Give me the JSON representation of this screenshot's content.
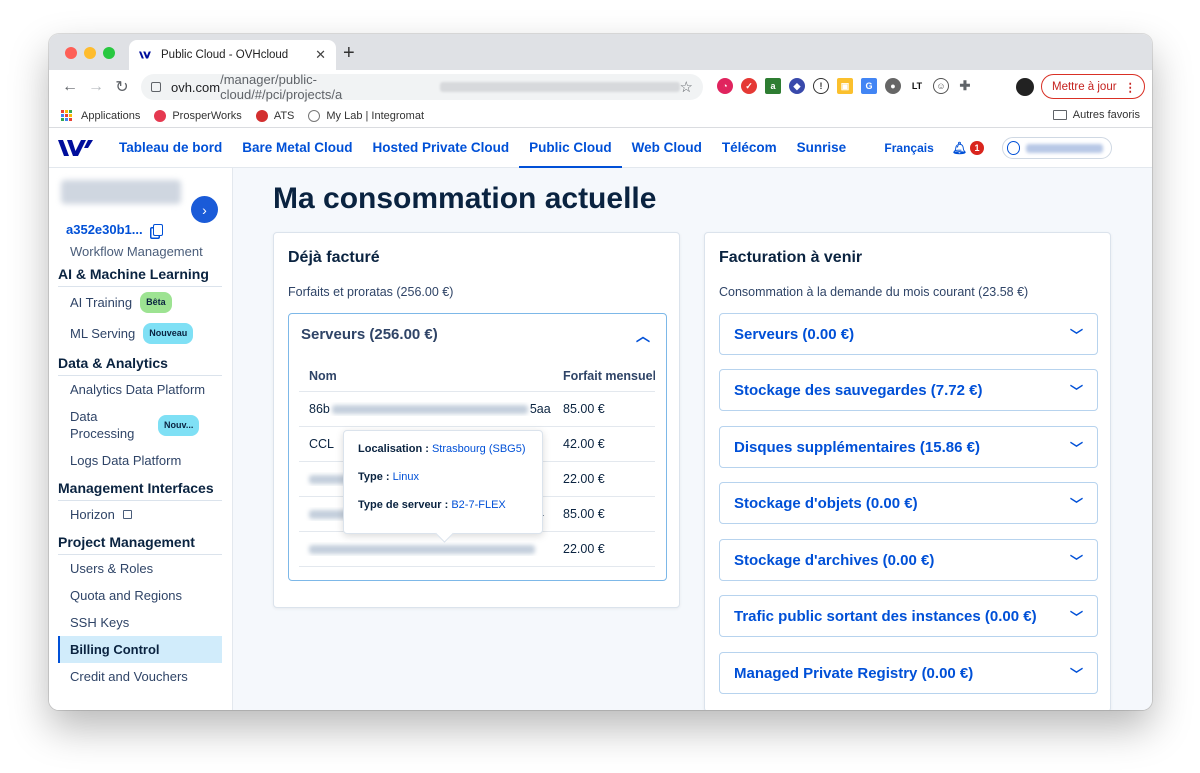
{
  "browser": {
    "tab_title": "Public Cloud - OVHcloud",
    "url_host": "ovh.com",
    "url_path": "/manager/public-cloud/#/pci/projects/a",
    "update_label": "Mettre à jour",
    "bookmarks": [
      "Applications",
      "ProsperWorks",
      "ATS",
      "My Lab | Integromat"
    ],
    "other_bookmarks": "Autres favoris"
  },
  "header": {
    "nav": [
      "Tableau de bord",
      "Bare Metal Cloud",
      "Hosted Private Cloud",
      "Public Cloud",
      "Web Cloud",
      "Télécom",
      "Sunrise"
    ],
    "active_nav": "Public Cloud",
    "language": "Français",
    "notifications": "1"
  },
  "sidebar": {
    "project_id": "a352e30b1...",
    "trimmed_item": "Workflow Management",
    "sections": [
      {
        "title": "AI & Machine Learning",
        "items": [
          {
            "label": "AI Training",
            "tag": "Bêta"
          },
          {
            "label": "ML Serving",
            "tag": "Nouveau"
          }
        ]
      },
      {
        "title": "Data & Analytics",
        "items": [
          {
            "label": "Analytics Data Platform"
          },
          {
            "label": "Data Processing",
            "tag": "Nouv..."
          },
          {
            "label": "Logs Data Platform"
          }
        ]
      },
      {
        "title": "Management Interfaces",
        "items": [
          {
            "label": "Horizon"
          }
        ]
      },
      {
        "title": "Project Management",
        "items": [
          {
            "label": "Users & Roles"
          },
          {
            "label": "Quota and Regions"
          },
          {
            "label": "SSH Keys"
          },
          {
            "label": "Billing Control"
          },
          {
            "label": "Credit and Vouchers"
          }
        ]
      }
    ]
  },
  "main": {
    "title": "Ma consommation actuelle",
    "billed": {
      "title": "Déjà facturé",
      "subtitle": "Forfaits et proratas  (256.00 €)",
      "servers_label": "Serveurs (256.00 €)",
      "columns": [
        "Nom",
        "Forfait mensuel"
      ],
      "rows": [
        {
          "name": "86b",
          "name_end": "5aa",
          "price": "85.00 €"
        },
        {
          "name": "CCL",
          "name_end": "",
          "price": "42.00 €"
        },
        {
          "name": "",
          "name_end": "",
          "price": "22.00 €"
        },
        {
          "name": "",
          "name_end": "4",
          "price": "85.00 €"
        },
        {
          "name": "",
          "name_end": "",
          "price": "22.00 €"
        }
      ],
      "tooltip": {
        "loc_label": "Localisation :",
        "loc_value": "Strasbourg (SBG5)",
        "type_label": "Type :",
        "type_value": "Linux",
        "server_label": "Type de serveur :",
        "server_value": "B2-7-FLEX"
      }
    },
    "upcoming": {
      "title": "Facturation à venir",
      "subtitle": "Consommation à la demande du mois courant  (23.58 €)",
      "items": [
        "Serveurs (0.00 €)",
        "Stockage des sauvegardes (7.72 €)",
        "Disques supplémentaires (15.86 €)",
        "Stockage d'objets (0.00 €)",
        "Stockage d'archives (0.00 €)",
        "Trafic public sortant des instances (0.00 €)",
        "Managed Private Registry (0.00 €)"
      ]
    }
  }
}
